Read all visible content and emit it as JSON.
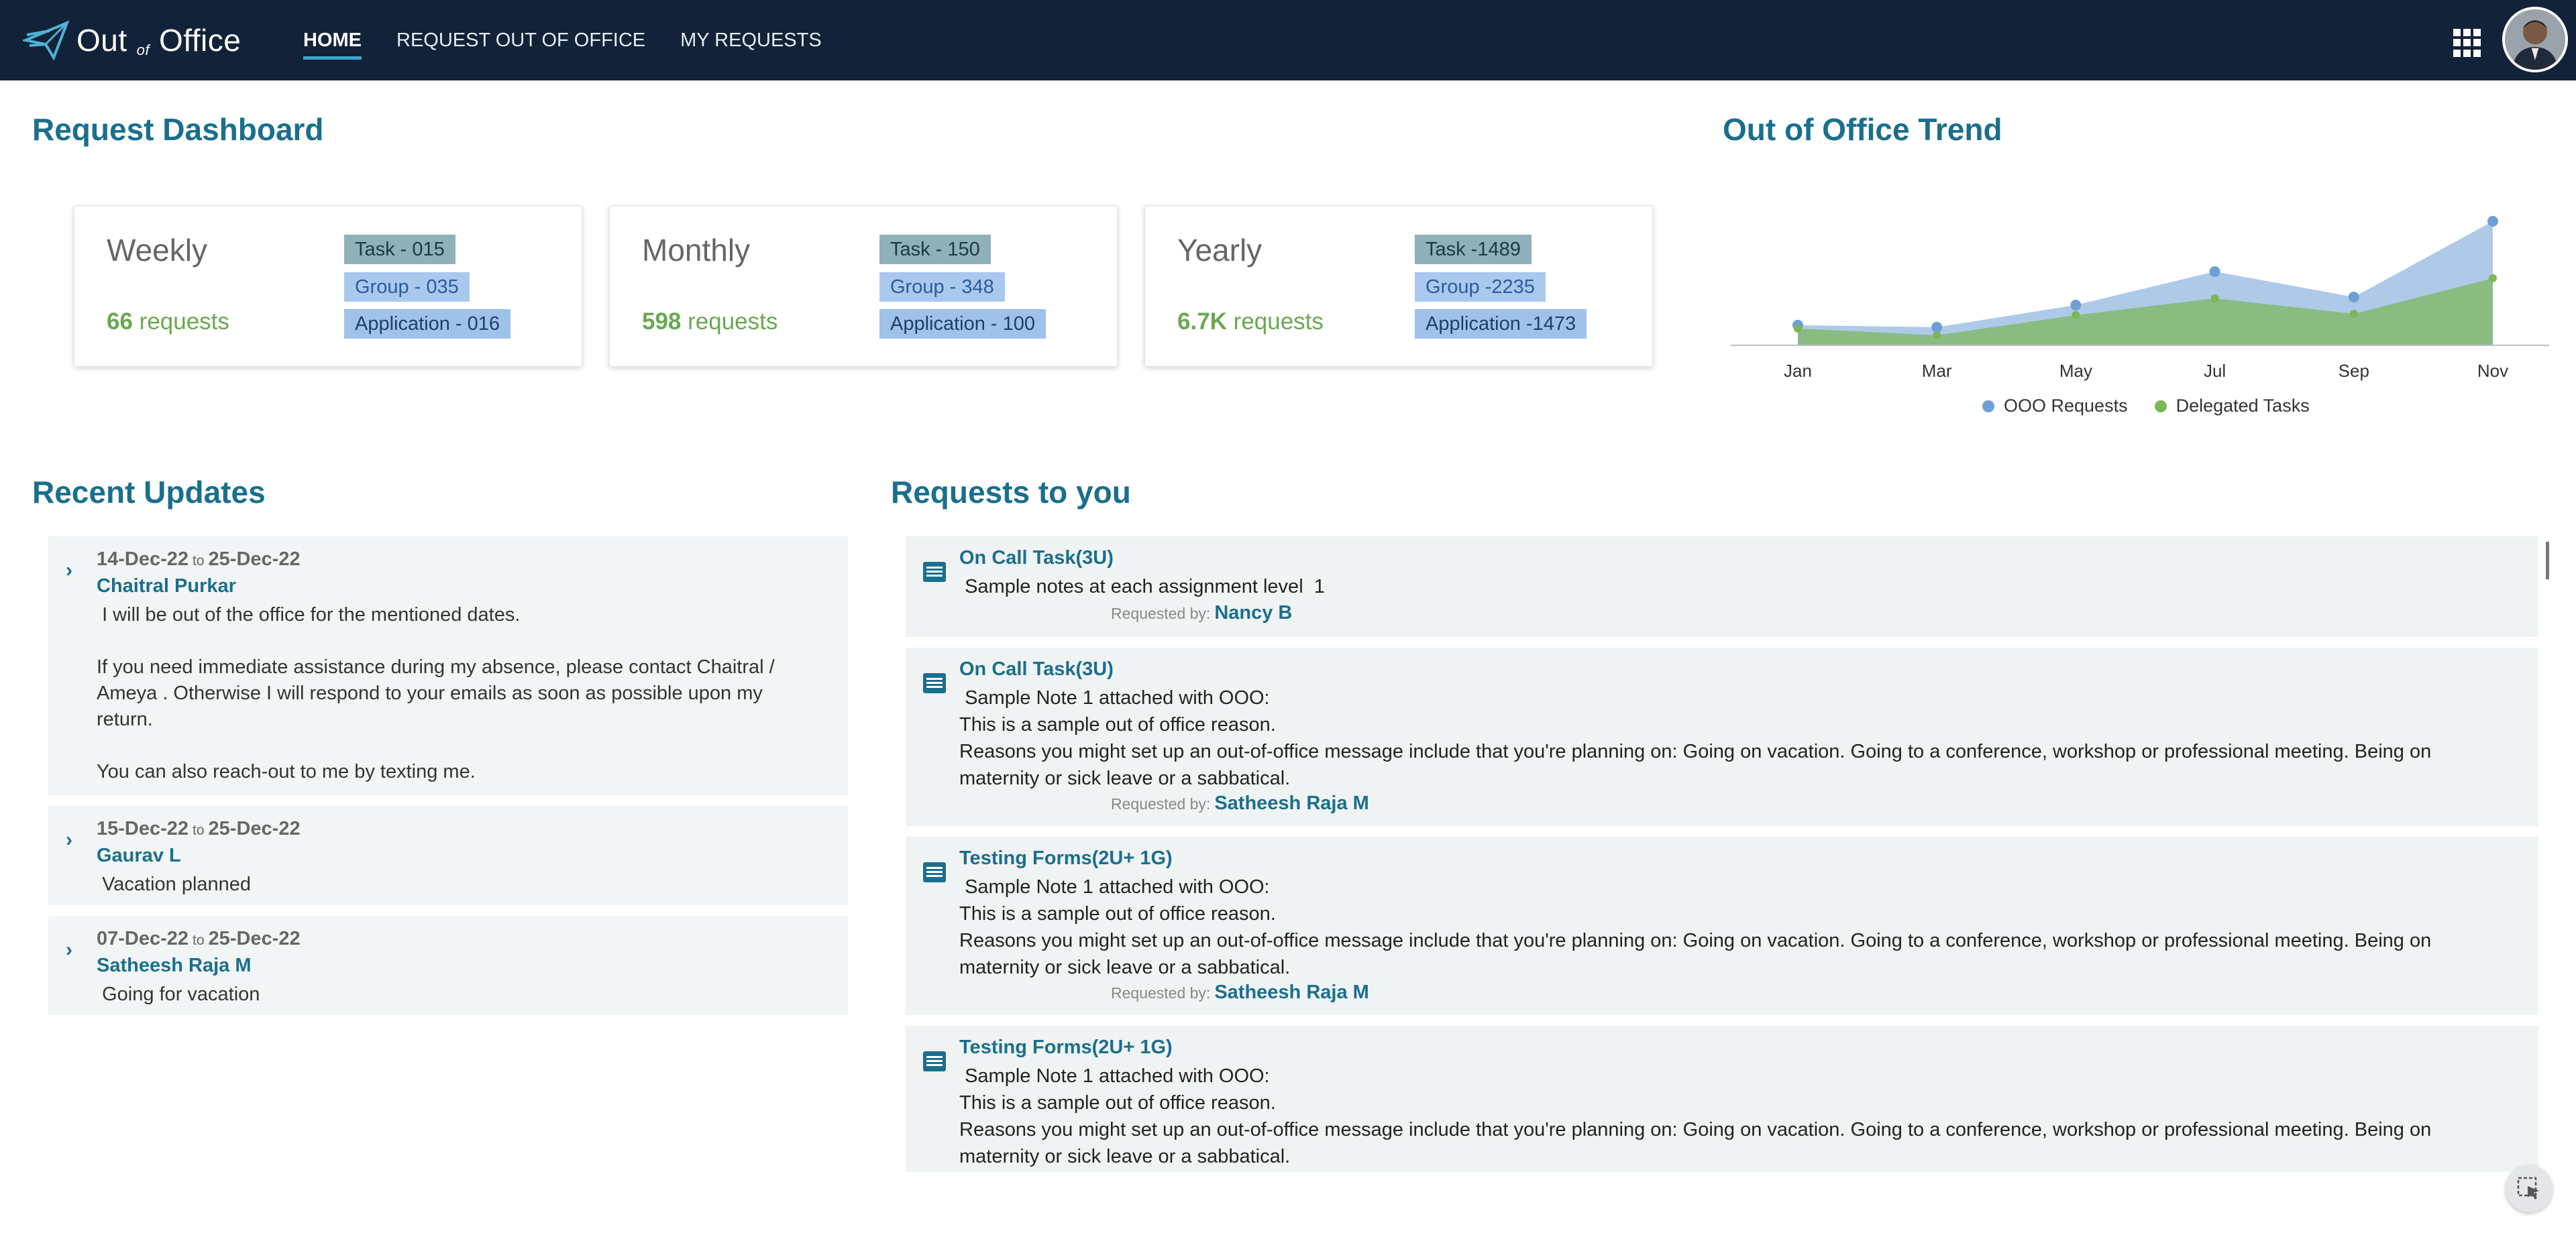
{
  "app": {
    "logo_left": "Out",
    "logo_of": "of",
    "logo_right": "Office"
  },
  "nav": [
    {
      "label": "HOME",
      "active": true
    },
    {
      "label": "REQUEST OUT OF OFFICE",
      "active": false
    },
    {
      "label": "MY REQUESTS",
      "active": false
    }
  ],
  "icons": {
    "apps": "apps-grid-icon",
    "avatar": "user-avatar",
    "help": "cursor-select-icon"
  },
  "dashboard": {
    "title": "Request Dashboard",
    "cards": [
      {
        "label": "Weekly",
        "count": "66",
        "count_suffix": " requests",
        "task": "Task - 015",
        "group": "Group - 035",
        "application": "Application - 016"
      },
      {
        "label": "Monthly",
        "count": "598",
        "count_suffix": " requests",
        "task": "Task - 150",
        "group": "Group - 348",
        "application": "Application - 100"
      },
      {
        "label": "Yearly",
        "count": "6.7K",
        "count_suffix": " requests",
        "task": "Task -1489",
        "group": "Group -2235",
        "application": "Application -1473"
      }
    ]
  },
  "trend": {
    "title": "Out of Office Trend"
  },
  "chart_data": {
    "type": "area",
    "title": "Out of Office Trend",
    "categories": [
      "Jan",
      "Mar",
      "May",
      "Jul",
      "Sep",
      "Nov"
    ],
    "series": [
      {
        "name": "OOO Requests",
        "values": [
          30,
          27,
          60,
          110,
          72,
          185
        ],
        "color": "#6c9fd6"
      },
      {
        "name": "Delegated Tasks",
        "values": [
          25,
          15,
          45,
          70,
          47,
          100
        ],
        "color": "#7bb657"
      }
    ],
    "ylim": [
      0,
      200
    ],
    "grid": false,
    "legend": "bottom"
  },
  "recent": {
    "title": "Recent Updates",
    "to_label": "to",
    "items": [
      {
        "from": "14-Dec-22",
        "to": "25-Dec-22",
        "name": "Chaitral Purkar",
        "message": " I will be out of the office for the mentioned dates.\n\nIf you need immediate assistance during my absence, please contact Chaitral / Ameya . Otherwise I will respond to your emails as soon as possible upon my return.\n\nYou can also reach-out to me by texting me."
      },
      {
        "from": "15-Dec-22",
        "to": "25-Dec-22",
        "name": "Gaurav L",
        "message": " Vacation planned"
      },
      {
        "from": "07-Dec-22",
        "to": "25-Dec-22",
        "name": "Satheesh Raja M",
        "message": " Going for vacation"
      }
    ]
  },
  "requests": {
    "title": "Requests to you",
    "by_label": "Requested by:",
    "items": [
      {
        "title": "On Call Task(3U)",
        "body": " Sample notes at each assignment level  1",
        "by": "Nancy B"
      },
      {
        "title": "On Call Task(3U)",
        "body": " Sample Note 1 attached with OOO:\nThis is a sample out of office reason.\nReasons you might set up an out-of-office message include that you're planning on: Going on vacation. Going to a conference, workshop or professional meeting. Being on maternity or sick leave or a sabbatical.",
        "by": "Satheesh Raja M"
      },
      {
        "title": "Testing Forms(2U+ 1G)",
        "body": " Sample Note 1 attached with OOO:\nThis is a sample out of office reason.\nReasons you might set up an out-of-office message include that you're planning on: Going on vacation. Going to a conference, workshop or professional meeting. Being on maternity or sick leave or a sabbatical.",
        "by": "Satheesh Raja M"
      },
      {
        "title": "Testing Forms(2U+ 1G)",
        "body": " Sample Note 1 attached with OOO:\nThis is a sample out of office reason.\nReasons you might set up an out-of-office message include that you're planning on: Going on vacation. Going to a conference, workshop or professional meeting. Being on maternity or sick leave or a sabbatical.",
        "by": ""
      }
    ]
  }
}
